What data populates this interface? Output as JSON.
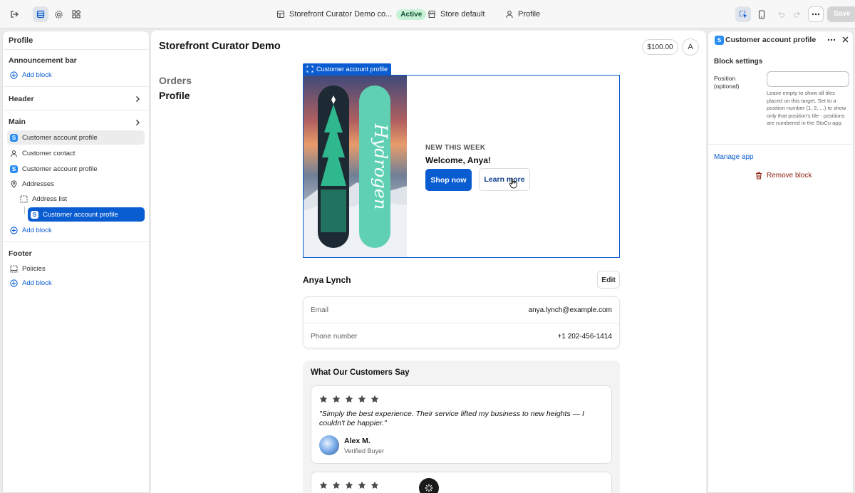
{
  "topbar": {
    "store_name": "Storefront Curator Demo co...",
    "status_badge": "Active",
    "theme_label": "Store default",
    "page_label": "Profile",
    "save_label": "Save"
  },
  "left_panel": {
    "title": "Profile",
    "sections": {
      "announcement": {
        "title": "Announcement bar",
        "add_label": "Add block"
      },
      "header": {
        "title": "Header"
      },
      "main": {
        "title": "Main",
        "items": [
          {
            "label": "Customer account profile"
          },
          {
            "label": "Customer contact"
          },
          {
            "label": "Customer account profile"
          },
          {
            "label": "Addresses"
          },
          {
            "label": "Address list"
          },
          {
            "label": "Customer account profile"
          }
        ],
        "add_label": "Add block"
      },
      "footer": {
        "title": "Footer",
        "items": [
          {
            "label": "Policies"
          }
        ],
        "add_label": "Add block"
      }
    }
  },
  "canvas": {
    "store_title": "Storefront Curator Demo",
    "cart_total": "$100.00",
    "account_initial": "A",
    "nav": {
      "orders": "Orders",
      "profile": "Profile"
    },
    "block_tag": "Customer account profile",
    "hero": {
      "eyebrow": "NEW THIS WEEK",
      "title": "Welcome, Anya!",
      "primary_button": "Shop now",
      "secondary_button": "Learn more",
      "board_text": "Hydrogen"
    },
    "customer": {
      "name": "Anya Lynch",
      "edit_label": "Edit",
      "fields": [
        {
          "label": "Email",
          "value": "anya.lynch@example.com"
        },
        {
          "label": "Phone number",
          "value": "+1 202-456-1414"
        }
      ]
    },
    "testimonials": {
      "title": "What Our Customers Say",
      "items": [
        {
          "rating": 5,
          "quote": "\"Simply the best experience. Their service lifted my business to new heights — I couldn't be happier.\"",
          "author": "Alex M.",
          "role": "Verified Buyer"
        },
        {
          "rating": 5
        }
      ]
    }
  },
  "right_panel": {
    "title": "Customer account profile",
    "section_title": "Block settings",
    "position_label": "Position (optional)",
    "position_value": "",
    "position_help": "Leave empty to show all tiles placed on this target. Set to a position number (1, 2, ...) to show only that position's tile - positions are numbered in the StoCu app.",
    "manage_link": "Manage app",
    "remove_label": "Remove block"
  },
  "colors": {
    "accent": "#0a5cd1",
    "active_badge_bg": "#c9f1d6",
    "remove_red": "#8e1f0b"
  }
}
